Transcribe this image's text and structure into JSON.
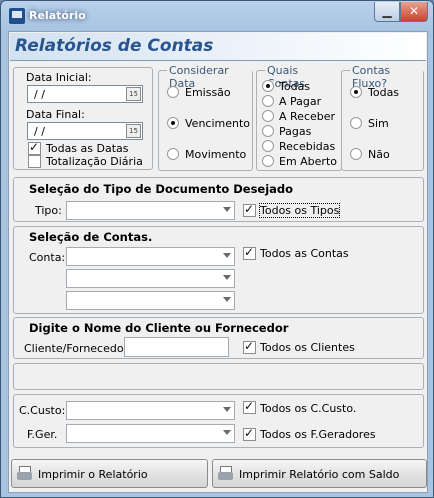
{
  "window": {
    "title": "Relatório"
  },
  "header": {
    "title": "Relatórios de Contas"
  },
  "dates": {
    "start_label": "Data Inicial:",
    "start_value": " /  /",
    "end_label": "Data Final:",
    "end_value": " /  /",
    "calendar_glyph": "15",
    "all_dates_label": "Todas as Datas",
    "all_dates_checked": true,
    "daily_total_label": "Totalização Diária",
    "daily_total_checked": false
  },
  "consider": {
    "title": "Considerar Data",
    "options": [
      "Emissão",
      "Vencimento",
      "Movimento"
    ],
    "selected": "Vencimento"
  },
  "accounts_which": {
    "title": "Quais Contas",
    "options": [
      "Todas",
      "A Pagar",
      "A Receber",
      "Pagas",
      "Recebidas",
      "Em Aberto"
    ],
    "selected": "Todas"
  },
  "flow": {
    "title": "Contas Fluxo?",
    "options": [
      "Todas",
      "Sim",
      "Não"
    ],
    "selected": "Todas"
  },
  "doc_type": {
    "heading": "Seleção do Tipo de Documento Desejado",
    "label": "Tipo:",
    "value": "",
    "all_label": "Todos os Tipos",
    "all_checked": true
  },
  "accounts": {
    "heading": "Seleção de Contas.",
    "label": "Conta:",
    "values": [
      "",
      "",
      ""
    ],
    "all_label": "Todos as Contas",
    "all_checked": true
  },
  "client": {
    "heading": "Digite o Nome do Cliente ou Fornecedor",
    "label": "Cliente/Fornecedor:",
    "value": "",
    "all_label": "Todos os Clientes",
    "all_checked": true
  },
  "cost": {
    "center_label": "C.Custo:",
    "center_value": "",
    "center_all_label": "Todos os C.Custo.",
    "center_all_checked": true,
    "gen_label": "F.Ger.",
    "gen_value": "",
    "gen_all_label": "Todos os F.Geradores",
    "gen_all_checked": true
  },
  "actions": {
    "print_label": "Imprimir o Relatório",
    "print_balance_label": "Imprimir Relatório com Saldo"
  }
}
